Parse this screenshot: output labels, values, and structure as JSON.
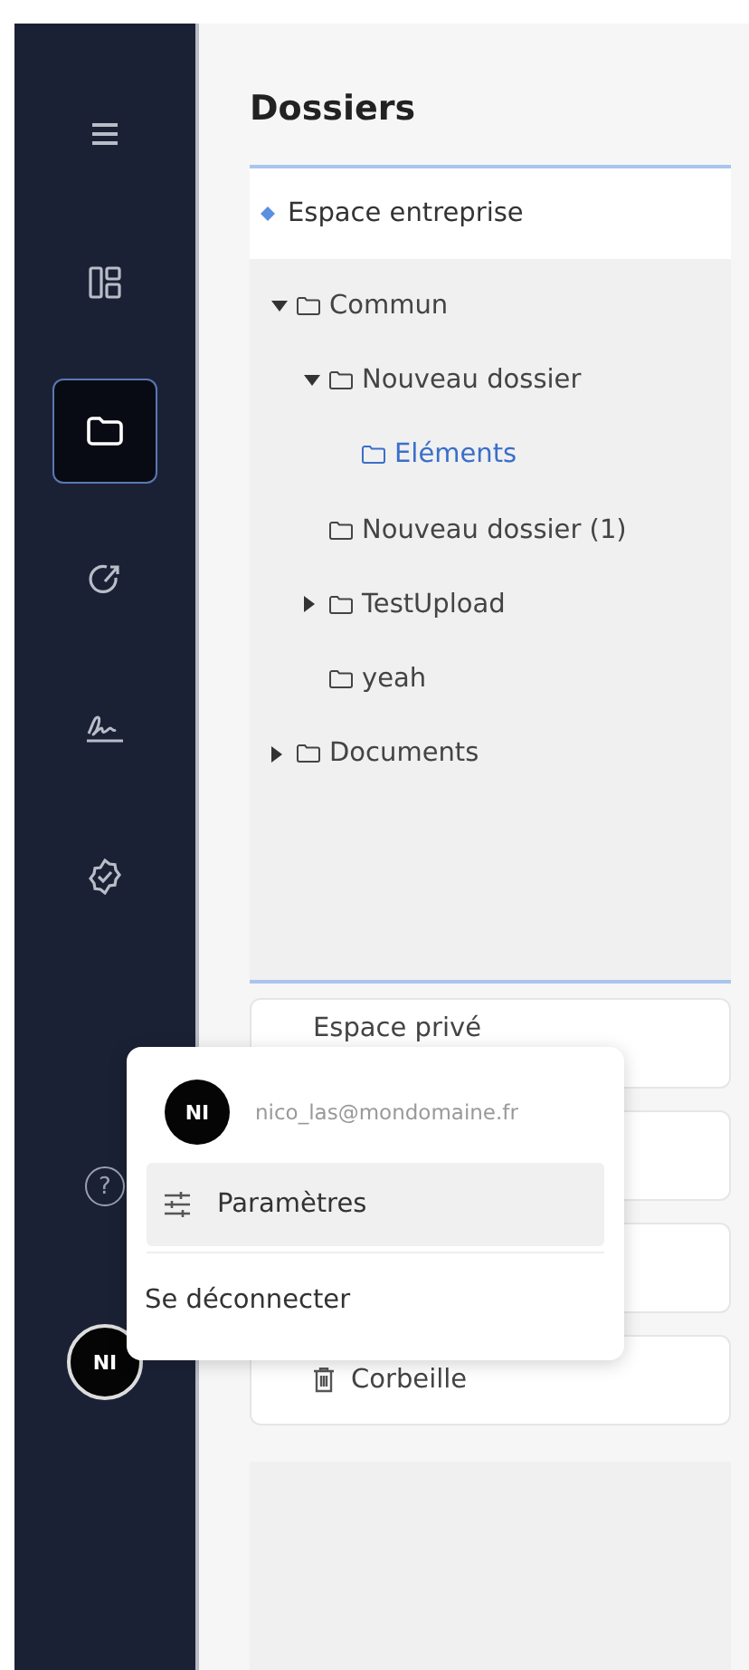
{
  "sidebar": {
    "items": [
      {
        "selected": false
      },
      {
        "selected": false
      },
      {
        "selected": true
      },
      {
        "selected": false
      },
      {
        "selected": false
      },
      {
        "selected": false
      }
    ],
    "help": "?",
    "avatar": "NI"
  },
  "title": "Dossiers",
  "space": {
    "label": "Espace entreprise"
  },
  "tree": [
    {
      "label": "Commun",
      "kind": "branch",
      "expanded": true,
      "selected": false,
      "children": [
        {
          "label": "Nouveau dossier",
          "kind": "branch",
          "expanded": true,
          "selected": false,
          "children": [
            {
              "label": "Eléments",
              "kind": "leaf",
              "selected": true
            }
          ]
        },
        {
          "label": "Nouveau dossier (1)",
          "kind": "leaf",
          "selected": false
        },
        {
          "label": "TestUpload",
          "kind": "branch",
          "expanded": false,
          "selected": false
        },
        {
          "label": "yeah",
          "kind": "leaf",
          "selected": false
        }
      ]
    },
    {
      "label": "Documents",
      "kind": "branch",
      "expanded": false,
      "selected": false
    }
  ],
  "cards": [
    {
      "kind": "text",
      "label": "Espace privé"
    },
    {
      "kind": "blank"
    },
    {
      "kind": "blank"
    },
    {
      "kind": "trash",
      "label": "Corbeille"
    }
  ],
  "user_menu": {
    "avatar": "NI",
    "email": "nico_las@mondomaine.fr",
    "items": [
      {
        "label": "Paramètres",
        "selected": true
      },
      {
        "label": "Se déconnecter",
        "selected": false
      }
    ]
  }
}
